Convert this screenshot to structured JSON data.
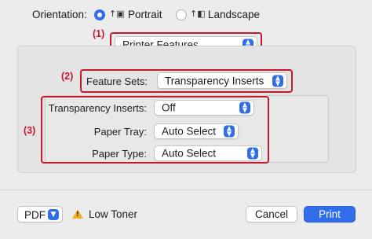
{
  "orientation": {
    "label": "Orientation:",
    "portrait_label": "Portrait",
    "landscape_label": "Landscape",
    "selected": "Portrait"
  },
  "callouts": {
    "one": "(1)",
    "two": "(2)",
    "three": "(3)"
  },
  "section_popup": {
    "value": "Printer Features"
  },
  "feature_sets": {
    "label": "Feature Sets:",
    "value": "Transparency Inserts"
  },
  "settings": [
    {
      "label": "Transparency Inserts:",
      "value": "Off"
    },
    {
      "label": "Paper Tray:",
      "value": "Auto Select"
    },
    {
      "label": "Paper Type:",
      "value": "Auto Select"
    }
  ],
  "footer": {
    "pdf_label": "PDF",
    "warning_text": "Low Toner",
    "cancel_label": "Cancel",
    "print_label": "Print"
  },
  "colors": {
    "accent": "#2f6ee8",
    "callout": "#c4192f",
    "warning": "#f3b01c"
  },
  "icons": {
    "portrait": "portrait-orientation-icon",
    "landscape": "landscape-orientation-icon",
    "popup": "chevron-updown-icon",
    "warning": "warning-triangle-icon"
  }
}
